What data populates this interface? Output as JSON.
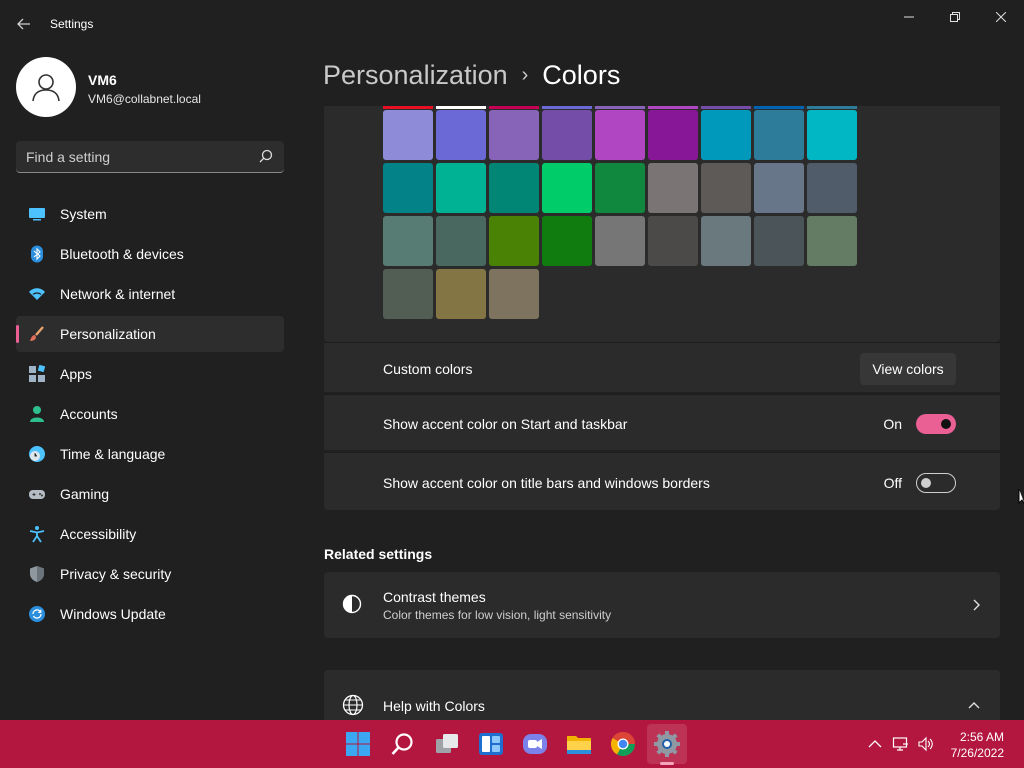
{
  "window": {
    "title": "Settings",
    "back_icon": "back-arrow-icon",
    "controls": [
      "minimize-icon",
      "restore-icon",
      "close-icon"
    ]
  },
  "profile": {
    "name": "VM6",
    "email": "VM6@collabnet.local"
  },
  "search": {
    "placeholder": "Find a setting"
  },
  "nav": {
    "items": [
      {
        "label": "System",
        "icon": "monitor-icon"
      },
      {
        "label": "Bluetooth & devices",
        "icon": "bluetooth-icon"
      },
      {
        "label": "Network & internet",
        "icon": "wifi-icon"
      },
      {
        "label": "Personalization",
        "icon": "brush-icon",
        "active": true
      },
      {
        "label": "Apps",
        "icon": "apps-icon"
      },
      {
        "label": "Accounts",
        "icon": "person-icon"
      },
      {
        "label": "Time & language",
        "icon": "clock-globe-icon"
      },
      {
        "label": "Gaming",
        "icon": "gamepad-icon"
      },
      {
        "label": "Accessibility",
        "icon": "accessibility-icon"
      },
      {
        "label": "Privacy & security",
        "icon": "shield-icon"
      },
      {
        "label": "Windows Update",
        "icon": "update-icon"
      }
    ]
  },
  "breadcrumb": {
    "parent": "Personalization",
    "separator": "›",
    "current": "Colors"
  },
  "accent_colors": {
    "top_row_partial": [
      "#e81123",
      "#ffffff",
      "#c30052",
      "#6b69d6",
      "#8764b8",
      "#b146c2",
      "#744da9",
      "#0063b1",
      "#2d7d9a"
    ],
    "rows": [
      [
        "#8e8cd8",
        "#6b69d6",
        "#8764b8",
        "#744da9",
        "#b146c2",
        "#881798",
        "#0099bc",
        "#2d7d9a",
        "#00b7c3"
      ],
      [
        "#038387",
        "#00b294",
        "#018574",
        "#00cc6a",
        "#10893e",
        "#7a7574",
        "#5d5a58",
        "#68768a",
        "#515c6b"
      ],
      [
        "#567c73",
        "#486860",
        "#498205",
        "#107c10",
        "#767676",
        "#4c4a48",
        "#69797e",
        "#4a5459",
        "#647c64"
      ],
      [
        "#525e54",
        "#847545",
        "#7e735f"
      ]
    ]
  },
  "custom_colors": {
    "label": "Custom colors",
    "button": "View colors"
  },
  "toggles": [
    {
      "label": "Show accent color on Start and taskbar",
      "state": "On",
      "on": true
    },
    {
      "label": "Show accent color on title bars and windows borders",
      "state": "Off",
      "on": false
    }
  ],
  "related": {
    "title": "Related settings",
    "contrast": {
      "title": "Contrast themes",
      "subtitle": "Color themes for low vision, light sensitivity",
      "icon": "contrast-icon"
    },
    "help": {
      "title": "Help with Colors",
      "icon": "globe-icon"
    }
  },
  "taskbar": {
    "color": "#b3173f",
    "apps": [
      "windows-start-icon",
      "search-icon",
      "task-view-icon",
      "widgets-icon",
      "teams-chat-icon",
      "file-explorer-icon",
      "chrome-icon",
      "settings-icon"
    ],
    "tray": [
      "chevron-up-icon",
      "network-icon",
      "volume-icon"
    ],
    "time": "2:56 AM",
    "date": "7/26/2022"
  },
  "colors": {
    "accent": "#ea5f94",
    "background": "#202020",
    "card": "#2b2b2b"
  }
}
